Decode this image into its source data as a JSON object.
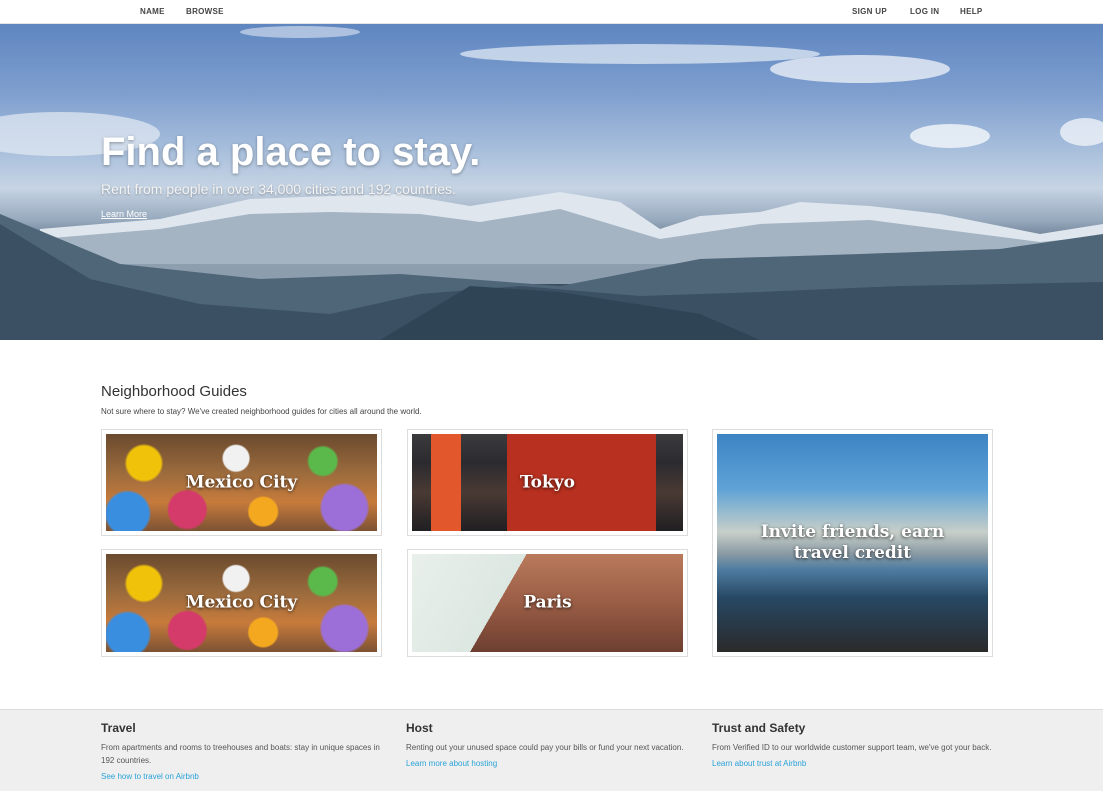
{
  "nav": {
    "left": [
      "NAME",
      "BROWSE"
    ],
    "right": [
      "SIGN UP",
      "LOG IN",
      "HELP"
    ]
  },
  "hero": {
    "title": "Find a place to stay.",
    "subtitle": "Rent from people in over 34,000 cities and 192 countries.",
    "link": "Learn More"
  },
  "guides": {
    "title": "Neighborhood Guides",
    "subtitle": "Not sure where to stay? We've created neighborhood guides for cities all around the world.",
    "cards": [
      "Mexico City",
      "Tokyo",
      "Mexico City",
      "Paris"
    ],
    "invite": "Invite friends, earn travel credit"
  },
  "footer": {
    "travel": {
      "title": "Travel",
      "text": "From apartments and rooms to treehouses and boats: stay in unique spaces in 192 countries.",
      "link": "See how to travel on Airbnb"
    },
    "host": {
      "title": "Host",
      "text": "Renting out your unused space could pay your bills or fund your next vacation.",
      "link": "Learn more about hosting"
    },
    "trust": {
      "title": "Trust and Safety",
      "text": "From Verified ID to our worldwide customer support team, we've got your back.",
      "link": "Learn about trust at Airbnb"
    }
  },
  "colors": {
    "link": "#2aa2d8",
    "footer_bg": "#efefef"
  }
}
